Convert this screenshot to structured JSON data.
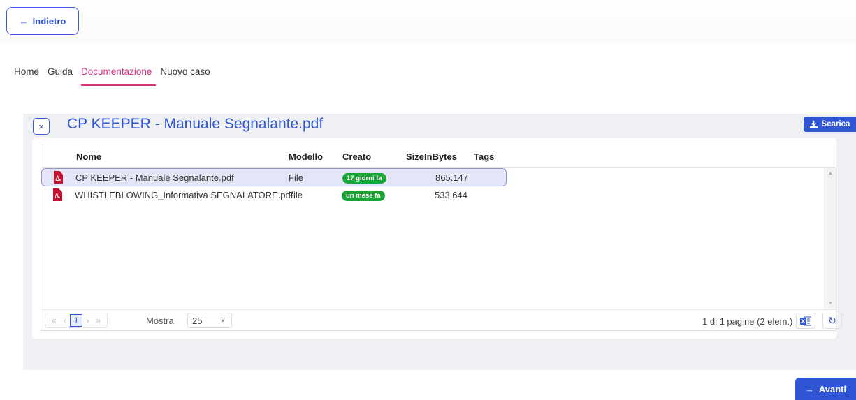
{
  "back_button": {
    "label": "Indietro",
    "icon": "arrow-left-icon"
  },
  "nav": {
    "items": [
      {
        "label": "Home",
        "active": false
      },
      {
        "label": "Guida",
        "active": false
      },
      {
        "label": "Documentazione",
        "active": true
      },
      {
        "label": "Nuovo caso",
        "active": false
      }
    ]
  },
  "document": {
    "close_label": "×",
    "title": "CP KEEPER - Manuale Segnalante.pdf",
    "download_label": "Scarica"
  },
  "grid": {
    "columns": [
      "Nome",
      "Modello",
      "Creato",
      "SizeInBytes",
      "Tags"
    ],
    "rows": [
      {
        "name": "CP KEEPER - Manuale Segnalante.pdf",
        "model": "File",
        "created": "17 giorni fa",
        "size": "865.147",
        "tags": "",
        "selected": true,
        "icon": "pdf-icon"
      },
      {
        "name": "WHISTLEBLOWING_Informativa SEGNALATORE.pdf",
        "model": "File",
        "created": "un mese fa",
        "size": "533.644",
        "tags": "",
        "selected": false,
        "icon": "pdf-icon"
      }
    ]
  },
  "pager": {
    "first": "«",
    "prev": "‹",
    "current_page": "1",
    "next": "›",
    "last": "»",
    "show_label": "Mostra",
    "page_size": "25",
    "info": "1 di 1 pagine (2 elem.)"
  },
  "next_button": {
    "label": "Avanti",
    "icon": "arrow-right-icon"
  },
  "colors": {
    "accent": "#2f55d4",
    "active_nav": "#d63384",
    "badge": "#1aa336",
    "pdf": "#c8102e"
  }
}
